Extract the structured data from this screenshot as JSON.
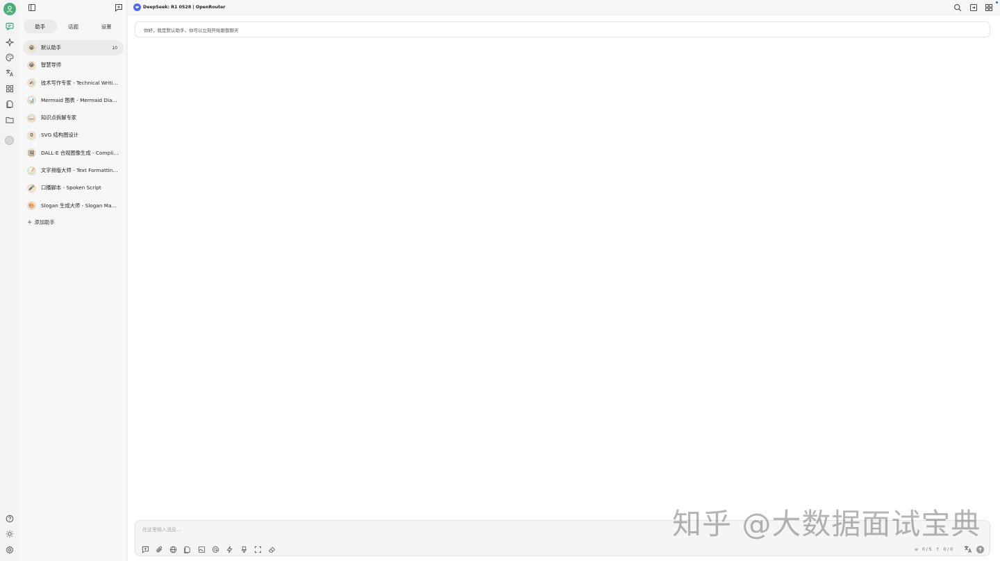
{
  "sidebar_tabs": [
    "助手",
    "话题",
    "设置"
  ],
  "assistants": [
    {
      "emoji": "😀",
      "name": "默认助手",
      "count": "10"
    },
    {
      "emoji": "😀",
      "name": "智慧导师"
    },
    {
      "emoji": "✍",
      "name": "技术写作专家 - Technical Writing Expert"
    },
    {
      "emoji": "📊",
      "name": "Mermaid 图表 - Mermaid Diagram"
    },
    {
      "emoji": "📖",
      "name": "知识点拆解专家"
    },
    {
      "emoji": "0",
      "name": "SVG 结构图设计"
    },
    {
      "emoji": "🖼",
      "name": "DALL·E 合规图像生成 - Compliant Image Generation"
    },
    {
      "emoji": "📝",
      "name": "文字排版大师 - Text Formatting Master"
    },
    {
      "emoji": "🎤",
      "name": "口播脚本 - Spoken Script"
    },
    {
      "emoji": "🎨",
      "name": "Slogan 生成大师 - Slogan Master"
    }
  ],
  "add_assistant_label": "添加助手",
  "model_title": "DeepSeek: R1 0528 | OpenRouter",
  "greeting": "你好，我是默认助手，你可以立刻开始跟我聊天",
  "composer": {
    "placeholder": "在这里输入消息...",
    "context_stat": "0 / 5",
    "token_stat": "0 / 0"
  },
  "watermark": "知乎 @大数据面试宝典",
  "colors": {
    "accent": "#1d9b5b",
    "model_logo": "#4d6bfe"
  }
}
